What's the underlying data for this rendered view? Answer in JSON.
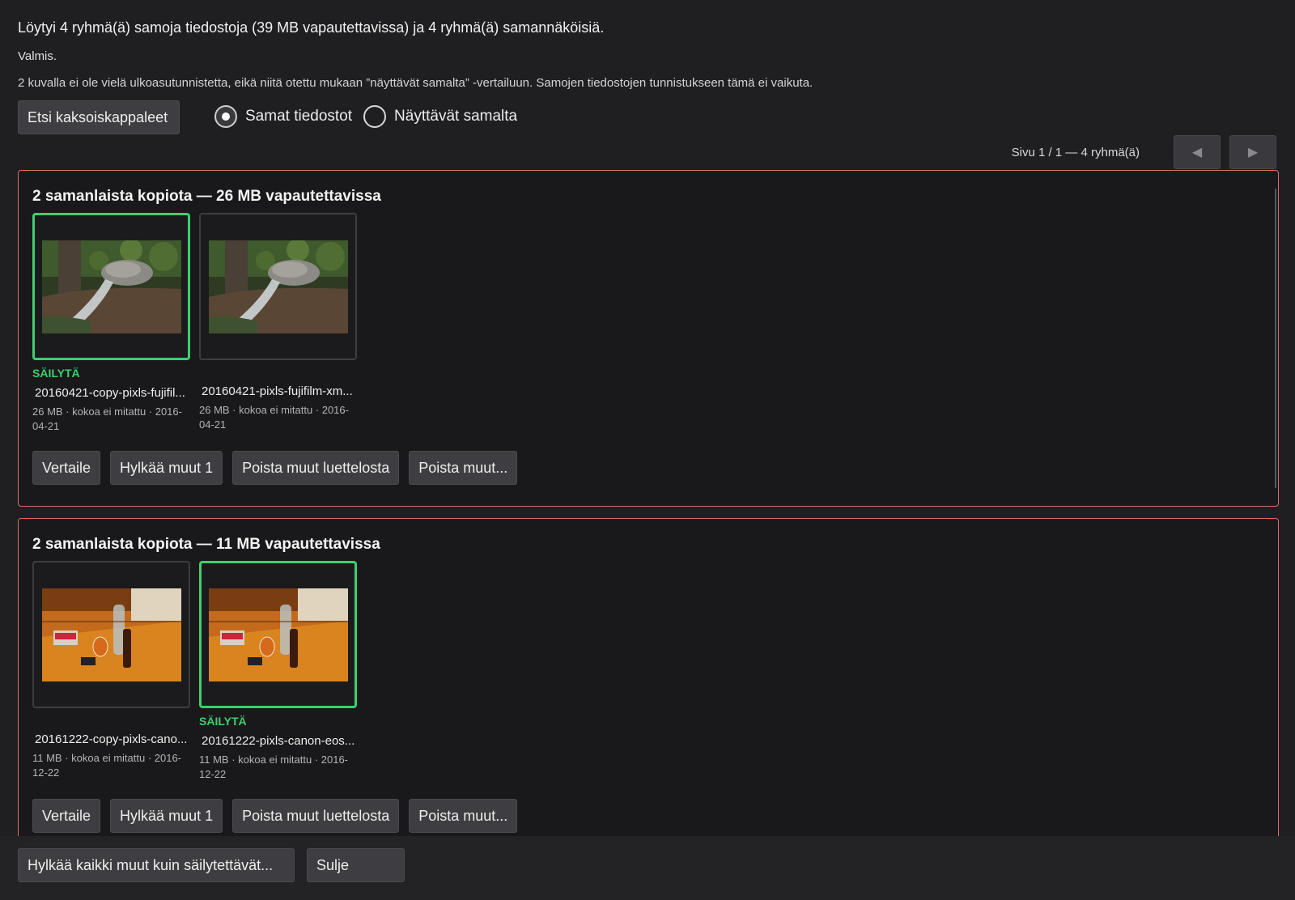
{
  "summary": "Löytyi 4 ryhmä(ä) samoja tiedostoja (39 MB vapautettavissa) ja 4 ryhmä(ä) samannäköisiä.",
  "status": "Valmis.",
  "note": "2 kuvalla ei ole vielä ulkoasutunnistetta, eikä niitä otettu mukaan ”näyttävät samalta” -vertailuun. Samojen tiedostojen tunnistukseen tämä ei vaikuta.",
  "find_button": "Etsi kaksoiskappaleet",
  "modes": [
    {
      "label": "Samat tiedostot",
      "selected": true
    },
    {
      "label": "Näyttävät samalta",
      "selected": false
    }
  ],
  "pager": {
    "label": "Sivu 1 / 1 — 4 ryhmä(ä)",
    "prev_icon": "triangle-left-icon",
    "next_icon": "triangle-right-icon"
  },
  "groups": [
    {
      "title": "2 samanlaista kopiota — 26 MB vapautettavissa",
      "items": [
        {
          "keep": true,
          "keep_label": "SÄILYTÄ",
          "filename": "20160421-copy-pixls-fujifil...",
          "meta": "26 MB · kokoa ei mitattu · 2016-04-21",
          "thumb": "forest-waterfall-photo"
        },
        {
          "keep": false,
          "keep_label": "",
          "filename": "20160421-pixls-fujifilm-xm...",
          "meta": "26 MB · kokoa ei mitattu · 2016-04-21",
          "thumb": "forest-waterfall-photo"
        }
      ],
      "actions": [
        "Vertaile",
        "Hylkää muut 1",
        "Poista muut luettelosta",
        "Poista muut..."
      ]
    },
    {
      "title": "2 samanlaista kopiota — 11 MB vapautettavissa",
      "items": [
        {
          "keep": false,
          "keep_label": "",
          "filename": "20161222-copy-pixls-cano...",
          "meta": "11 MB · kokoa ei mitattu · 2016-12-22",
          "thumb": "table-bottles-photo"
        },
        {
          "keep": true,
          "keep_label": "SÄILYTÄ",
          "filename": "20161222-pixls-canon-eos...",
          "meta": "11 MB · kokoa ei mitattu · 2016-12-22",
          "thumb": "table-bottles-photo"
        }
      ],
      "actions": [
        "Vertaile",
        "Hylkää muut 1",
        "Poista muut luettelosta",
        "Poista muut..."
      ]
    }
  ],
  "footer": {
    "reject_all": "Hylkää kaikki muut kuin säilytettävät...",
    "close": "Sulje"
  },
  "colors": {
    "keep_border": "#3fce6e",
    "group_border": "#e06a6a",
    "background": "#1f1f22"
  }
}
